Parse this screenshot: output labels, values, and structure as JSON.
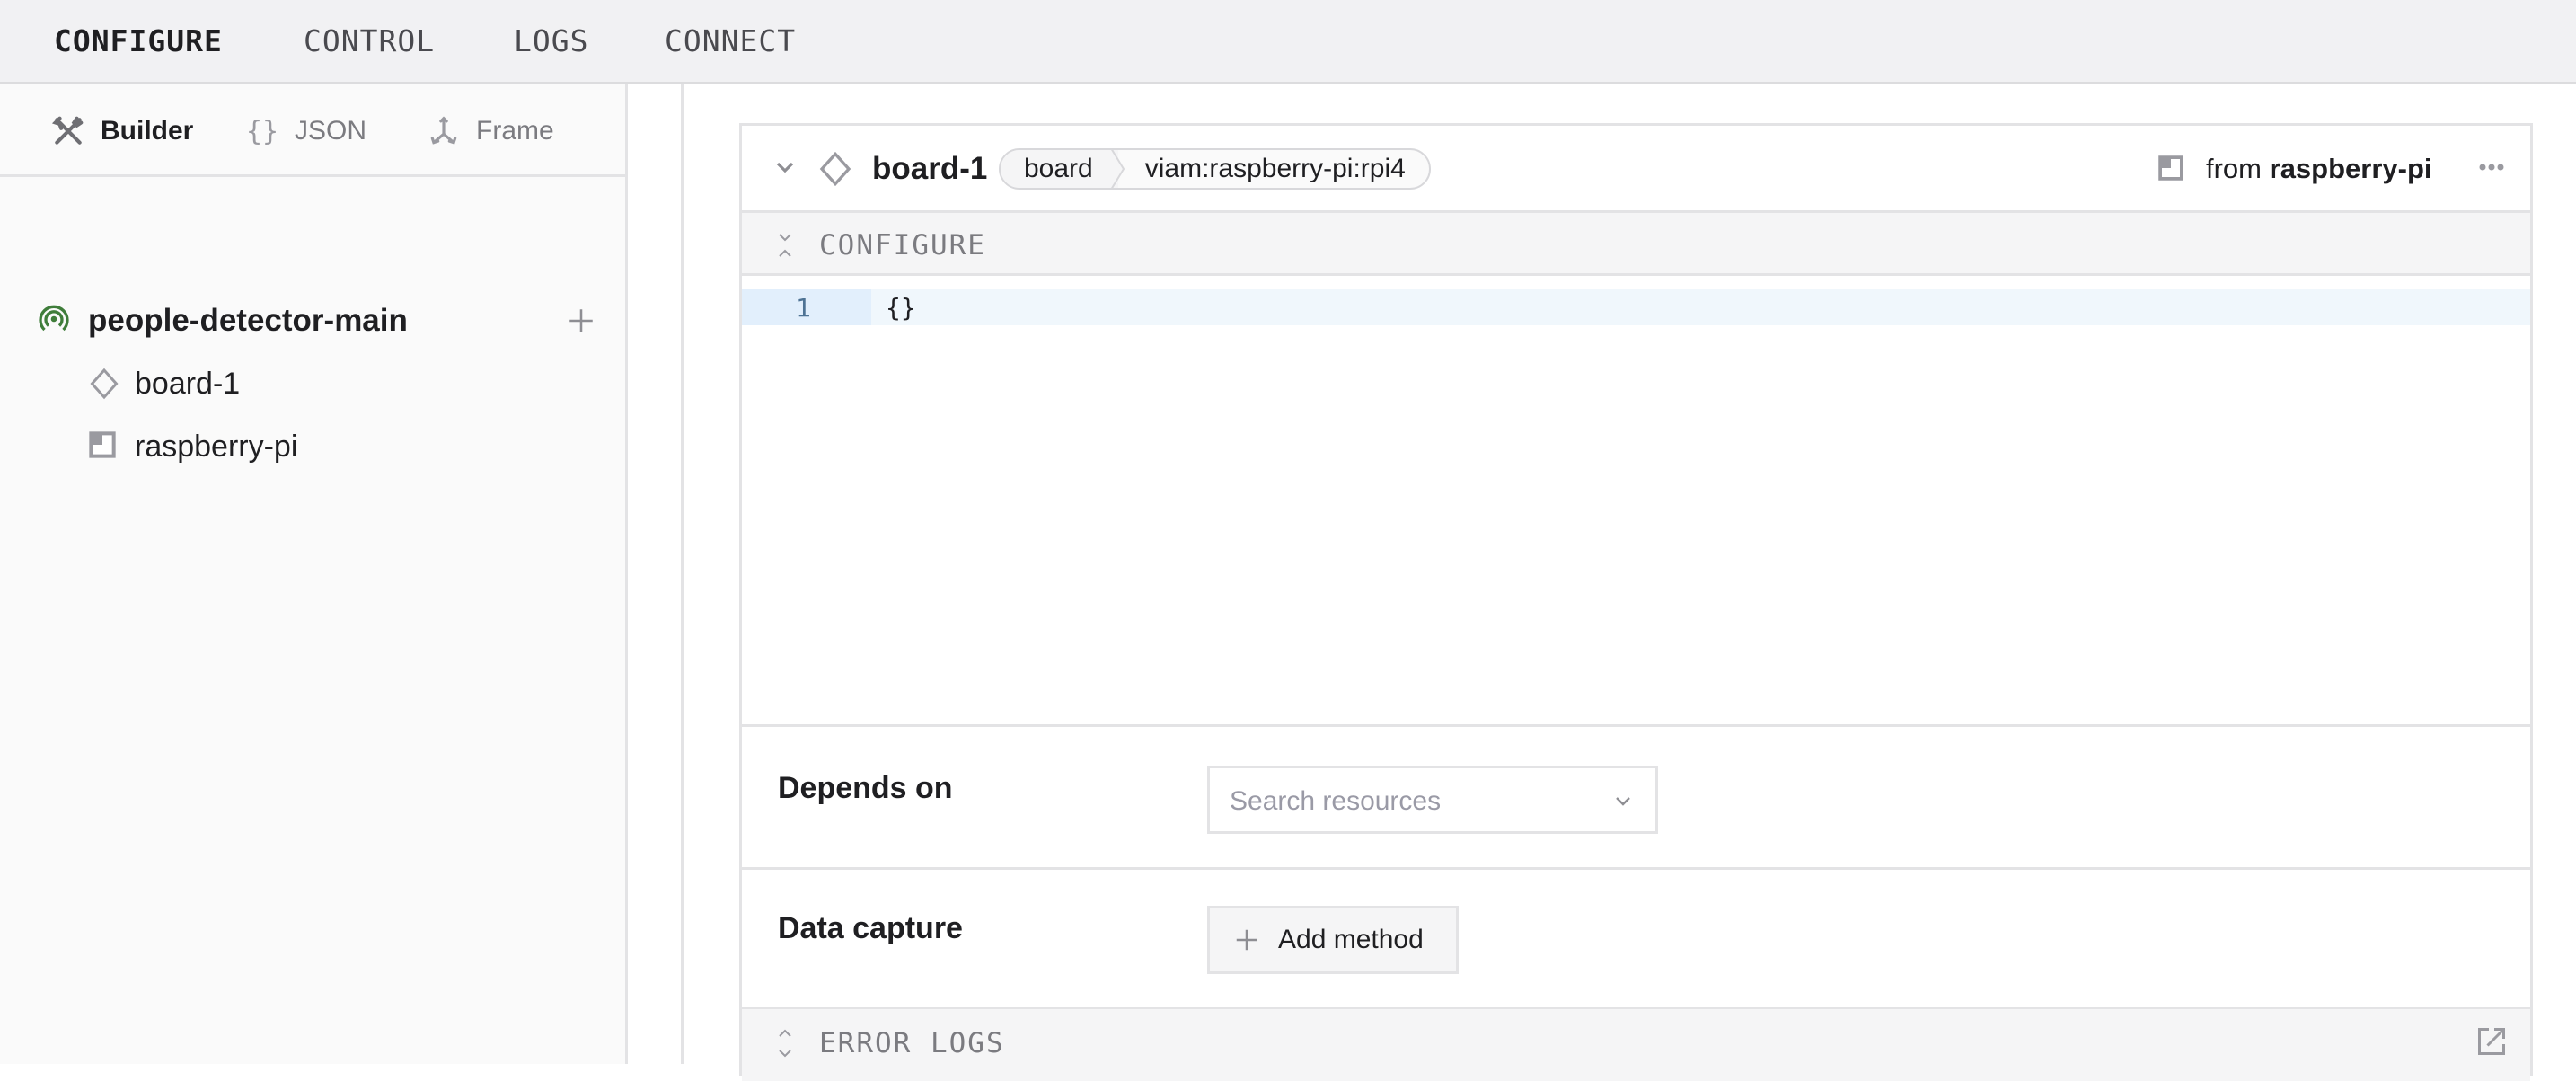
{
  "topnav": {
    "tabs": [
      {
        "label": "CONFIGURE",
        "active": true
      },
      {
        "label": "CONTROL",
        "active": false
      },
      {
        "label": "LOGS",
        "active": false
      },
      {
        "label": "CONNECT",
        "active": false
      }
    ]
  },
  "sidebar": {
    "subtabs": [
      {
        "label": "Builder",
        "icon": "tools-icon",
        "active": true
      },
      {
        "label": "JSON",
        "icon": "braces-icon",
        "active": false
      },
      {
        "label": "Frame",
        "icon": "axes-icon",
        "active": false
      }
    ],
    "tree": {
      "root": {
        "label": "people-detector-main",
        "icon": "online-signal-icon",
        "status_color": "#3f7d3a"
      },
      "add_icon": "plus-icon",
      "children": [
        {
          "label": "board-1",
          "icon": "diamond-icon"
        },
        {
          "label": "raspberry-pi",
          "icon": "fragment-icon"
        }
      ]
    }
  },
  "card": {
    "name": "board-1",
    "api_type": "board",
    "model": "viam:raspberry-pi:rpi4",
    "from_label": "from",
    "from_fragment": "raspberry-pi",
    "configure_label": "CONFIGURE",
    "editor": {
      "lines": [
        {
          "number": "1",
          "text": "{}"
        }
      ]
    },
    "depends_on": {
      "label": "Depends on",
      "placeholder": "Search resources"
    },
    "data_capture": {
      "label": "Data capture",
      "button_label": "Add method"
    },
    "error_logs_label": "ERROR LOGS"
  }
}
